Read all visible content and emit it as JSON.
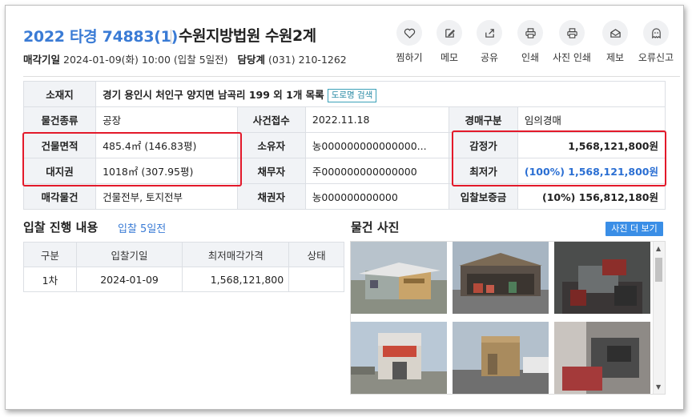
{
  "header": {
    "case_number": "2022 타경 74883(1)",
    "court": "수원지방법원 수원2계",
    "sale_date_label": "매각기일",
    "sale_date_value": "2024-01-09(화) 10:00 (입찰 5일전)",
    "dept_label": "담당계",
    "dept_value": "(031) 210-1262"
  },
  "actions": [
    {
      "label": "찜하기",
      "icon": "heart-icon"
    },
    {
      "label": "메모",
      "icon": "memo-icon"
    },
    {
      "label": "공유",
      "icon": "share-icon"
    },
    {
      "label": "인쇄",
      "icon": "print-icon"
    },
    {
      "label": "사진 인쇄",
      "icon": "photo-print-icon"
    },
    {
      "label": "제보",
      "icon": "report-icon"
    },
    {
      "label": "오류신고",
      "icon": "error-report-icon"
    }
  ],
  "info": {
    "location_label": "소재지",
    "location_value": "경기 용인시 처인구 양지면 남곡리 199 외 1개 목록",
    "road_button": "도로명 검색",
    "type_label": "물건종류",
    "type_value": "공장",
    "case_received_label": "사건접수",
    "case_received_value": "2022.11.18",
    "auction_kind_label": "경매구분",
    "auction_kind_value": "임의경매",
    "building_area_label": "건물면적",
    "building_area_value": "485.4㎡ (146.83평)",
    "owner_label": "소유자",
    "owner_value": "농000000000000000...",
    "appraisal_label": "감정가",
    "appraisal_value": "1,568,121,800원",
    "land_right_label": "대지권",
    "land_right_value": "1018㎡ (307.95평)",
    "debtor_label": "채무자",
    "debtor_value": "주000000000000000",
    "min_price_label": "최저가",
    "min_price_value": "(100%) 1,568,121,800원",
    "sale_object_label": "매각물건",
    "sale_object_value": "건물전부, 토지전부",
    "creditor_label": "채권자",
    "creditor_value": "농000000000000",
    "deposit_label": "입찰보증금",
    "deposit_value": "(10%) 156,812,180원"
  },
  "bid_progress": {
    "title": "입찰 진행 내용",
    "subtitle": "입찰 5일전",
    "columns": [
      "구분",
      "입찰기일",
      "최저매각가격",
      "상태"
    ],
    "rows": [
      [
        "1차",
        "2024-01-09",
        "1,568,121,800",
        ""
      ]
    ]
  },
  "photos": {
    "title": "물건 사진",
    "more_button": "사진 더 보기"
  }
}
